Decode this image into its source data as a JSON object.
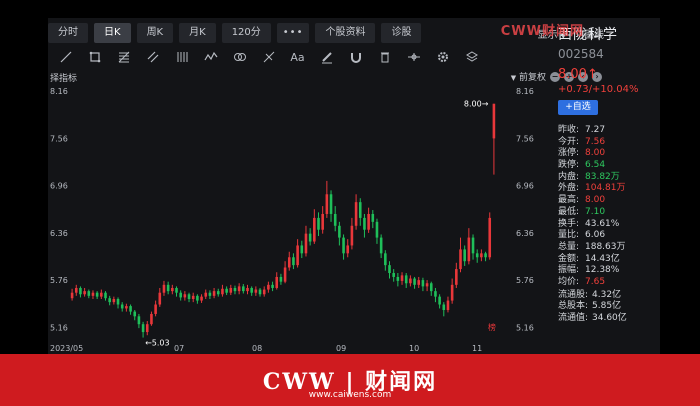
{
  "tabs": [
    {
      "label": "分时",
      "active": false
    },
    {
      "label": "日K",
      "active": true
    },
    {
      "label": "周K",
      "active": false
    },
    {
      "label": "月K",
      "active": false
    },
    {
      "label": "120分",
      "active": false
    },
    {
      "label": "•••",
      "active": false
    },
    {
      "label": "个股资料",
      "active": false
    },
    {
      "label": "诊股",
      "active": false
    }
  ],
  "tab_right": {
    "display": "显示",
    "line_draw": "画线"
  },
  "toolbar_icons": [
    "line-icon",
    "rect-icon",
    "fib-icon",
    "channel-icon",
    "parallel-icon",
    "wave-icon",
    "cycle-icon",
    "pitchfork-icon",
    "text-icon",
    "pen-icon",
    "magnet-icon",
    "trash-icon",
    "crosshair-icon",
    "settings-icon",
    "layers-icon"
  ],
  "text_tool_label": "Aa",
  "indicator": {
    "left": "择指标",
    "adjust": "前复权"
  },
  "watermark_top": "CWW财闻网",
  "stock": {
    "name": "西陇科学",
    "code": "002584",
    "price": "8.00",
    "change": "+0.73/+10.04%",
    "watch_label": "+自选"
  },
  "quote": [
    {
      "label": "昨收:",
      "value": "7.27",
      "color": "normal"
    },
    {
      "label": "今开:",
      "value": "7.56",
      "color": "up"
    },
    {
      "label": "涨停:",
      "value": "8.00",
      "color": "up"
    },
    {
      "label": "跌停:",
      "value": "6.54",
      "color": "down"
    },
    {
      "label": "内盘:",
      "value": "83.82万",
      "color": "down"
    },
    {
      "label": "外盘:",
      "value": "104.81万",
      "color": "up"
    },
    {
      "label": "最高:",
      "value": "8.00",
      "color": "up"
    },
    {
      "label": "最低:",
      "value": "7.10",
      "color": "down"
    },
    {
      "label": "换手:",
      "value": "43.61%",
      "color": "normal"
    },
    {
      "label": "量比:",
      "value": "6.06",
      "color": "normal"
    },
    {
      "label": "总量:",
      "value": "188.63万",
      "color": "normal"
    },
    {
      "label": "金额:",
      "value": "14.43亿",
      "color": "normal"
    },
    {
      "label": "振幅:",
      "value": "12.38%",
      "color": "normal"
    },
    {
      "label": "均价:",
      "value": "7.65",
      "color": "up"
    },
    {
      "label": "流通股:",
      "value": "4.32亿",
      "color": "normal"
    },
    {
      "label": "总股本:",
      "value": "5.85亿",
      "color": "normal"
    },
    {
      "label": "流通值:",
      "value": "34.60亿",
      "color": "normal"
    }
  ],
  "chart_data": {
    "type": "candlestick",
    "y_ticks": [
      "8.16",
      "7.56",
      "6.96",
      "6.36",
      "5.76",
      "5.16"
    ],
    "y_range": [
      5.05,
      8.2
    ],
    "x_ticks": [
      "2023/05",
      "07",
      "08",
      "09",
      "10",
      "11"
    ],
    "annotations": {
      "high": "8.00→",
      "low": "←5.03",
      "marker": "榜"
    },
    "candles": [
      {
        "o": 5.53,
        "c": 5.6,
        "h": 5.65,
        "l": 5.5
      },
      {
        "o": 5.6,
        "c": 5.66,
        "h": 5.7,
        "l": 5.56
      },
      {
        "o": 5.66,
        "c": 5.58,
        "h": 5.68,
        "l": 5.54
      },
      {
        "o": 5.58,
        "c": 5.62,
        "h": 5.66,
        "l": 5.55
      },
      {
        "o": 5.62,
        "c": 5.56,
        "h": 5.64,
        "l": 5.53
      },
      {
        "o": 5.56,
        "c": 5.6,
        "h": 5.63,
        "l": 5.52
      },
      {
        "o": 5.6,
        "c": 5.55,
        "h": 5.62,
        "l": 5.52
      },
      {
        "o": 5.55,
        "c": 5.6,
        "h": 5.64,
        "l": 5.52
      },
      {
        "o": 5.6,
        "c": 5.53,
        "h": 5.62,
        "l": 5.5
      },
      {
        "o": 5.53,
        "c": 5.48,
        "h": 5.56,
        "l": 5.44
      },
      {
        "o": 5.48,
        "c": 5.52,
        "h": 5.55,
        "l": 5.45
      },
      {
        "o": 5.52,
        "c": 5.45,
        "h": 5.54,
        "l": 5.4
      },
      {
        "o": 5.45,
        "c": 5.4,
        "h": 5.48,
        "l": 5.36
      },
      {
        "o": 5.4,
        "c": 5.43,
        "h": 5.46,
        "l": 5.36
      },
      {
        "o": 5.43,
        "c": 5.36,
        "h": 5.45,
        "l": 5.32
      },
      {
        "o": 5.36,
        "c": 5.3,
        "h": 5.38,
        "l": 5.25
      },
      {
        "o": 5.3,
        "c": 5.2,
        "h": 5.33,
        "l": 5.15
      },
      {
        "o": 5.2,
        "c": 5.1,
        "h": 5.23,
        "l": 5.03
      },
      {
        "o": 5.1,
        "c": 5.2,
        "h": 5.24,
        "l": 5.06
      },
      {
        "o": 5.2,
        "c": 5.33,
        "h": 5.36,
        "l": 5.18
      },
      {
        "o": 5.33,
        "c": 5.45,
        "h": 5.5,
        "l": 5.3
      },
      {
        "o": 5.45,
        "c": 5.6,
        "h": 5.66,
        "l": 5.42
      },
      {
        "o": 5.6,
        "c": 5.7,
        "h": 5.75,
        "l": 5.56
      },
      {
        "o": 5.7,
        "c": 5.62,
        "h": 5.74,
        "l": 5.58
      },
      {
        "o": 5.62,
        "c": 5.66,
        "h": 5.7,
        "l": 5.58
      },
      {
        "o": 5.66,
        "c": 5.6,
        "h": 5.68,
        "l": 5.55
      },
      {
        "o": 5.6,
        "c": 5.54,
        "h": 5.63,
        "l": 5.5
      },
      {
        "o": 5.54,
        "c": 5.58,
        "h": 5.62,
        "l": 5.5
      },
      {
        "o": 5.58,
        "c": 5.52,
        "h": 5.6,
        "l": 5.48
      },
      {
        "o": 5.52,
        "c": 5.56,
        "h": 5.6,
        "l": 5.48
      },
      {
        "o": 5.56,
        "c": 5.5,
        "h": 5.58,
        "l": 5.46
      },
      {
        "o": 5.5,
        "c": 5.55,
        "h": 5.58,
        "l": 5.47
      },
      {
        "o": 5.55,
        "c": 5.6,
        "h": 5.64,
        "l": 5.52
      },
      {
        "o": 5.6,
        "c": 5.56,
        "h": 5.63,
        "l": 5.52
      },
      {
        "o": 5.56,
        "c": 5.62,
        "h": 5.66,
        "l": 5.53
      },
      {
        "o": 5.62,
        "c": 5.58,
        "h": 5.65,
        "l": 5.55
      },
      {
        "o": 5.58,
        "c": 5.65,
        "h": 5.7,
        "l": 5.55
      },
      {
        "o": 5.65,
        "c": 5.6,
        "h": 5.68,
        "l": 5.57
      },
      {
        "o": 5.6,
        "c": 5.66,
        "h": 5.7,
        "l": 5.57
      },
      {
        "o": 5.66,
        "c": 5.62,
        "h": 5.69,
        "l": 5.58
      },
      {
        "o": 5.62,
        "c": 5.68,
        "h": 5.72,
        "l": 5.58
      },
      {
        "o": 5.68,
        "c": 5.62,
        "h": 5.71,
        "l": 5.59
      },
      {
        "o": 5.62,
        "c": 5.66,
        "h": 5.7,
        "l": 5.58
      },
      {
        "o": 5.66,
        "c": 5.6,
        "h": 5.68,
        "l": 5.56
      },
      {
        "o": 5.6,
        "c": 5.64,
        "h": 5.68,
        "l": 5.56
      },
      {
        "o": 5.64,
        "c": 5.58,
        "h": 5.66,
        "l": 5.55
      },
      {
        "o": 5.58,
        "c": 5.64,
        "h": 5.68,
        "l": 5.55
      },
      {
        "o": 5.64,
        "c": 5.7,
        "h": 5.74,
        "l": 5.6
      },
      {
        "o": 5.7,
        "c": 5.66,
        "h": 5.74,
        "l": 5.62
      },
      {
        "o": 5.66,
        "c": 5.8,
        "h": 5.86,
        "l": 5.64
      },
      {
        "o": 5.8,
        "c": 5.74,
        "h": 5.84,
        "l": 5.7
      },
      {
        "o": 5.74,
        "c": 5.92,
        "h": 6.0,
        "l": 5.72
      },
      {
        "o": 5.92,
        "c": 6.05,
        "h": 6.12,
        "l": 5.88
      },
      {
        "o": 6.05,
        "c": 5.95,
        "h": 6.1,
        "l": 5.9
      },
      {
        "o": 5.95,
        "c": 6.2,
        "h": 6.28,
        "l": 5.92
      },
      {
        "o": 6.2,
        "c": 6.1,
        "h": 6.26,
        "l": 6.04
      },
      {
        "o": 6.1,
        "c": 6.35,
        "h": 6.45,
        "l": 6.06
      },
      {
        "o": 6.35,
        "c": 6.25,
        "h": 6.42,
        "l": 6.2
      },
      {
        "o": 6.25,
        "c": 6.55,
        "h": 6.66,
        "l": 6.22
      },
      {
        "o": 6.55,
        "c": 6.4,
        "h": 6.62,
        "l": 6.32
      },
      {
        "o": 6.4,
        "c": 6.6,
        "h": 6.7,
        "l": 6.35
      },
      {
        "o": 6.6,
        "c": 6.85,
        "h": 7.02,
        "l": 6.55
      },
      {
        "o": 6.85,
        "c": 6.6,
        "h": 6.9,
        "l": 6.5
      },
      {
        "o": 6.6,
        "c": 6.45,
        "h": 6.7,
        "l": 6.38
      },
      {
        "o": 6.45,
        "c": 6.3,
        "h": 6.5,
        "l": 6.2
      },
      {
        "o": 6.3,
        "c": 6.1,
        "h": 6.34,
        "l": 6.02
      },
      {
        "o": 6.1,
        "c": 6.2,
        "h": 6.28,
        "l": 6.05
      },
      {
        "o": 6.2,
        "c": 6.45,
        "h": 6.55,
        "l": 6.15
      },
      {
        "o": 6.45,
        "c": 6.75,
        "h": 6.85,
        "l": 6.4
      },
      {
        "o": 6.75,
        "c": 6.55,
        "h": 6.8,
        "l": 6.45
      },
      {
        "o": 6.55,
        "c": 6.4,
        "h": 6.6,
        "l": 6.3
      },
      {
        "o": 6.4,
        "c": 6.6,
        "h": 6.68,
        "l": 6.36
      },
      {
        "o": 6.6,
        "c": 6.5,
        "h": 6.65,
        "l": 6.42
      },
      {
        "o": 6.5,
        "c": 6.3,
        "h": 6.54,
        "l": 6.22
      },
      {
        "o": 6.3,
        "c": 6.1,
        "h": 6.34,
        "l": 6.04
      },
      {
        "o": 6.1,
        "c": 5.95,
        "h": 6.14,
        "l": 5.88
      },
      {
        "o": 5.95,
        "c": 5.85,
        "h": 6.0,
        "l": 5.78
      },
      {
        "o": 5.85,
        "c": 5.8,
        "h": 5.9,
        "l": 5.74
      },
      {
        "o": 5.8,
        "c": 5.75,
        "h": 5.85,
        "l": 5.68
      },
      {
        "o": 5.75,
        "c": 5.82,
        "h": 5.86,
        "l": 5.7
      },
      {
        "o": 5.82,
        "c": 5.72,
        "h": 5.85,
        "l": 5.66
      },
      {
        "o": 5.72,
        "c": 5.78,
        "h": 5.82,
        "l": 5.68
      },
      {
        "o": 5.78,
        "c": 5.7,
        "h": 5.8,
        "l": 5.65
      },
      {
        "o": 5.7,
        "c": 5.76,
        "h": 5.8,
        "l": 5.66
      },
      {
        "o": 5.76,
        "c": 5.68,
        "h": 5.79,
        "l": 5.62
      },
      {
        "o": 5.68,
        "c": 5.72,
        "h": 5.76,
        "l": 5.62
      },
      {
        "o": 5.72,
        "c": 5.62,
        "h": 5.74,
        "l": 5.56
      },
      {
        "o": 5.62,
        "c": 5.55,
        "h": 5.66,
        "l": 5.48
      },
      {
        "o": 5.55,
        "c": 5.45,
        "h": 5.58,
        "l": 5.4
      },
      {
        "o": 5.45,
        "c": 5.38,
        "h": 5.48,
        "l": 5.3
      },
      {
        "o": 5.38,
        "c": 5.5,
        "h": 5.55,
        "l": 5.35
      },
      {
        "o": 5.5,
        "c": 5.7,
        "h": 5.78,
        "l": 5.46
      },
      {
        "o": 5.7,
        "c": 5.9,
        "h": 5.98,
        "l": 5.66
      },
      {
        "o": 5.9,
        "c": 6.15,
        "h": 6.3,
        "l": 5.86
      },
      {
        "o": 6.15,
        "c": 6.0,
        "h": 6.2,
        "l": 5.94
      },
      {
        "o": 6.0,
        "c": 6.3,
        "h": 6.42,
        "l": 5.96
      },
      {
        "o": 6.3,
        "c": 6.1,
        "h": 6.34,
        "l": 6.02
      },
      {
        "o": 6.1,
        "c": 6.05,
        "h": 6.15,
        "l": 5.98
      },
      {
        "o": 6.05,
        "c": 6.1,
        "h": 6.15,
        "l": 6.0
      },
      {
        "o": 6.1,
        "c": 6.05,
        "h": 6.12,
        "l": 6.0
      },
      {
        "o": 6.05,
        "c": 6.55,
        "h": 6.62,
        "l": 6.02
      },
      {
        "o": 7.56,
        "c": 8.0,
        "h": 8.0,
        "l": 7.1
      }
    ]
  }
}
